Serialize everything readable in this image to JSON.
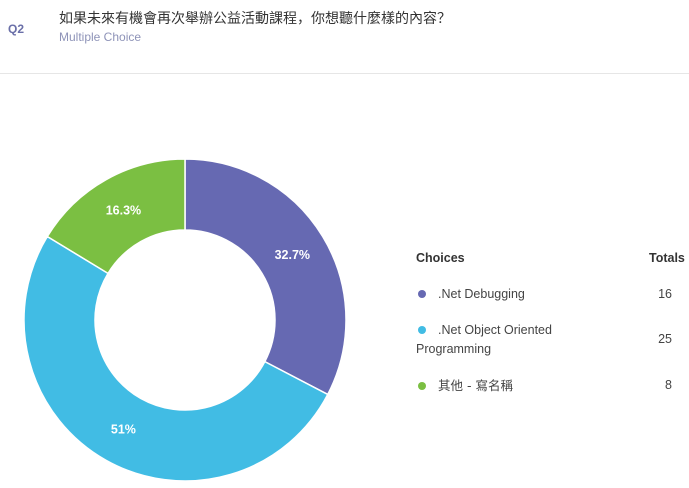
{
  "question": {
    "number": "Q2",
    "title": "如果未來有機會再次舉辦公益活動課程，你想聽什麼樣的內容？",
    "type": "Multiple Choice"
  },
  "legend": {
    "choices_header": "Choices",
    "totals_header": "Totals"
  },
  "chart_data": {
    "type": "pie",
    "donut": true,
    "slices": [
      {
        "label": ".Net Debugging",
        "total": 16,
        "percent_label": "32.7%",
        "color": "#6669b2"
      },
      {
        "label": ".Net Object Oriented Programming",
        "total": 25,
        "percent_label": "51%",
        "color": "#41bce4"
      },
      {
        "label": "其他 - 寫名稱",
        "total": 8,
        "percent_label": "16.3%",
        "color": "#7bbf42"
      }
    ]
  }
}
